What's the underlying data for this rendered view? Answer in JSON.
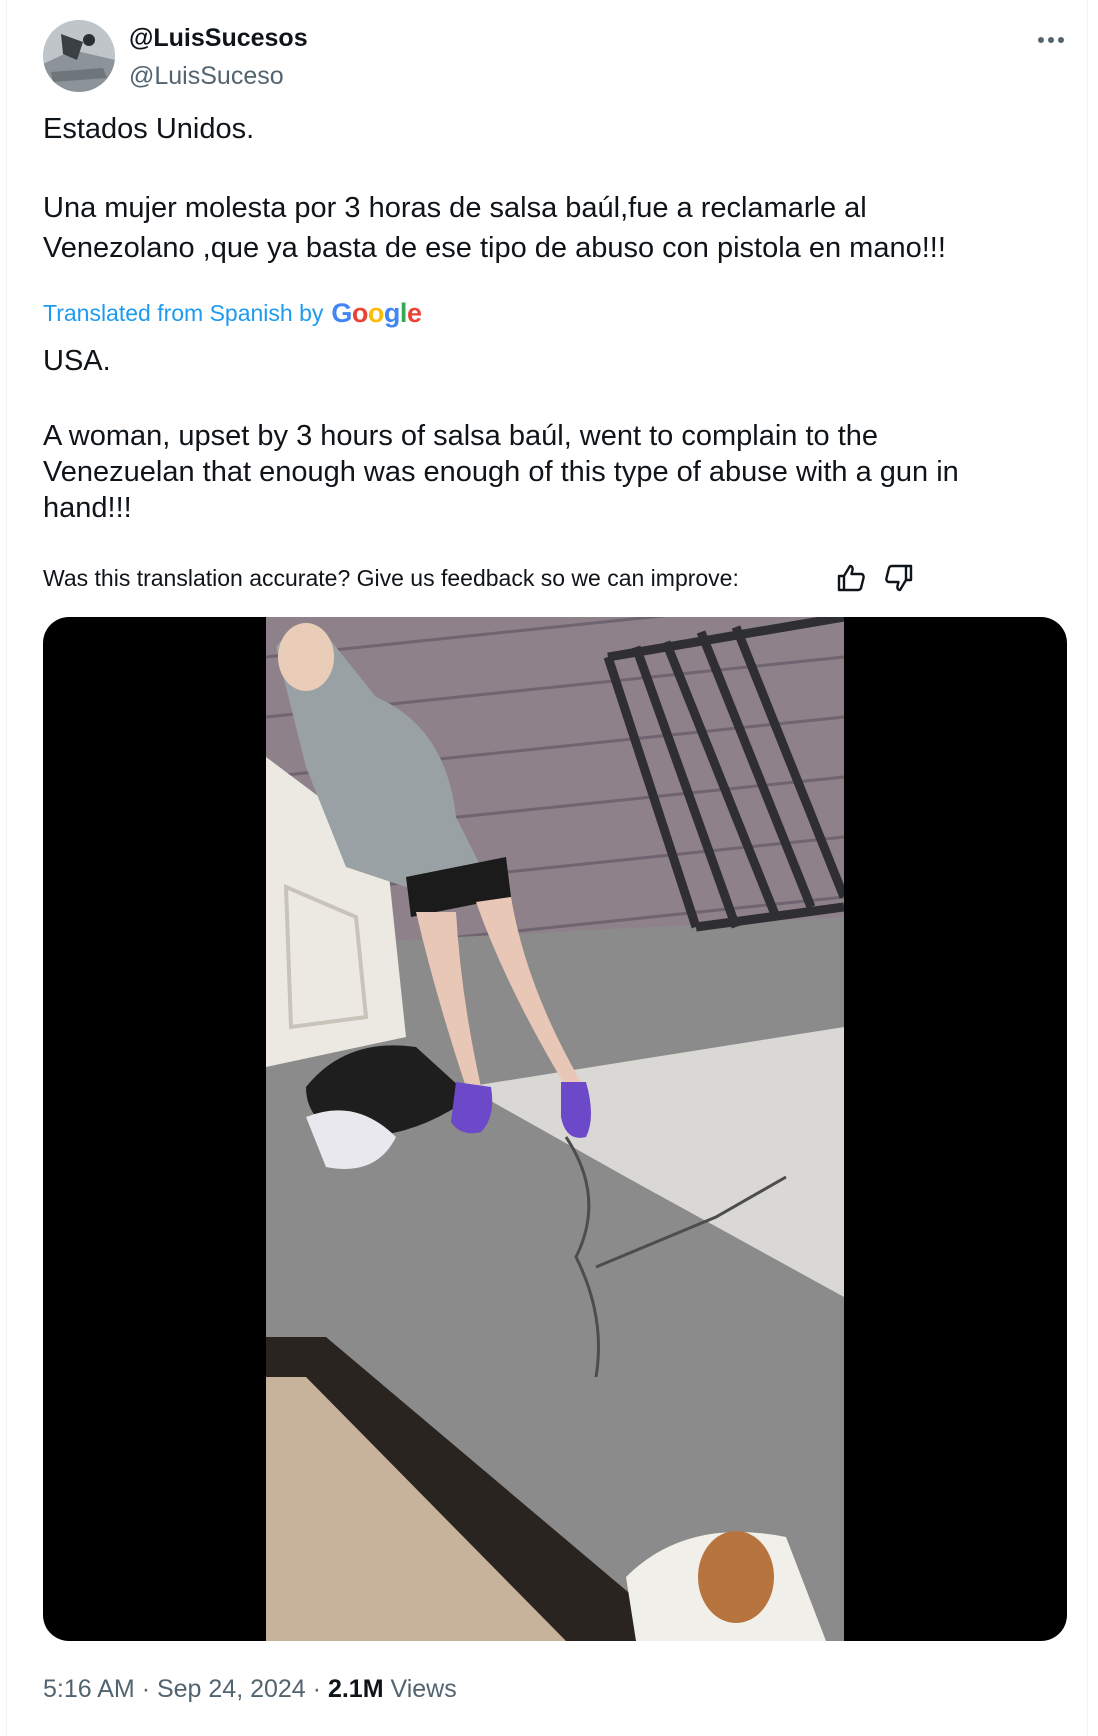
{
  "tweet": {
    "display_name": "@LuisSucesos",
    "handle": "@LuisSuceso",
    "more_icon": "more-dots-icon",
    "original_text": [
      "Estados Unidos.",
      "Una mujer molesta por 3 horas de salsa baúl,fue a reclamarle al",
      "Venezolano ,que ya basta de ese tipo de abuso con pistola en mano!!!"
    ],
    "translated_label": "Translated from Spanish by",
    "google_label": "Google",
    "translated_text": [
      "USA.",
      "A woman, upset by 3 hours of salsa baúl, went to complain to the",
      "Venezuelan that enough was enough of this type of abuse with a gun in",
      "hand!!!"
    ],
    "feedback_text": "Was this translation accurate? Give us feedback so we can improve:",
    "time": "5:16 AM",
    "sep": "·",
    "date": "Sep 24, 2024",
    "views_count": "2.1M",
    "views_label": "Views"
  },
  "colors": {
    "link_blue": "#1d9bf0",
    "secondary_text": "#536471",
    "google_blue": "#4285f4",
    "google_red": "#ea4335",
    "google_yellow": "#fbbc05",
    "google_green": "#34a853"
  }
}
